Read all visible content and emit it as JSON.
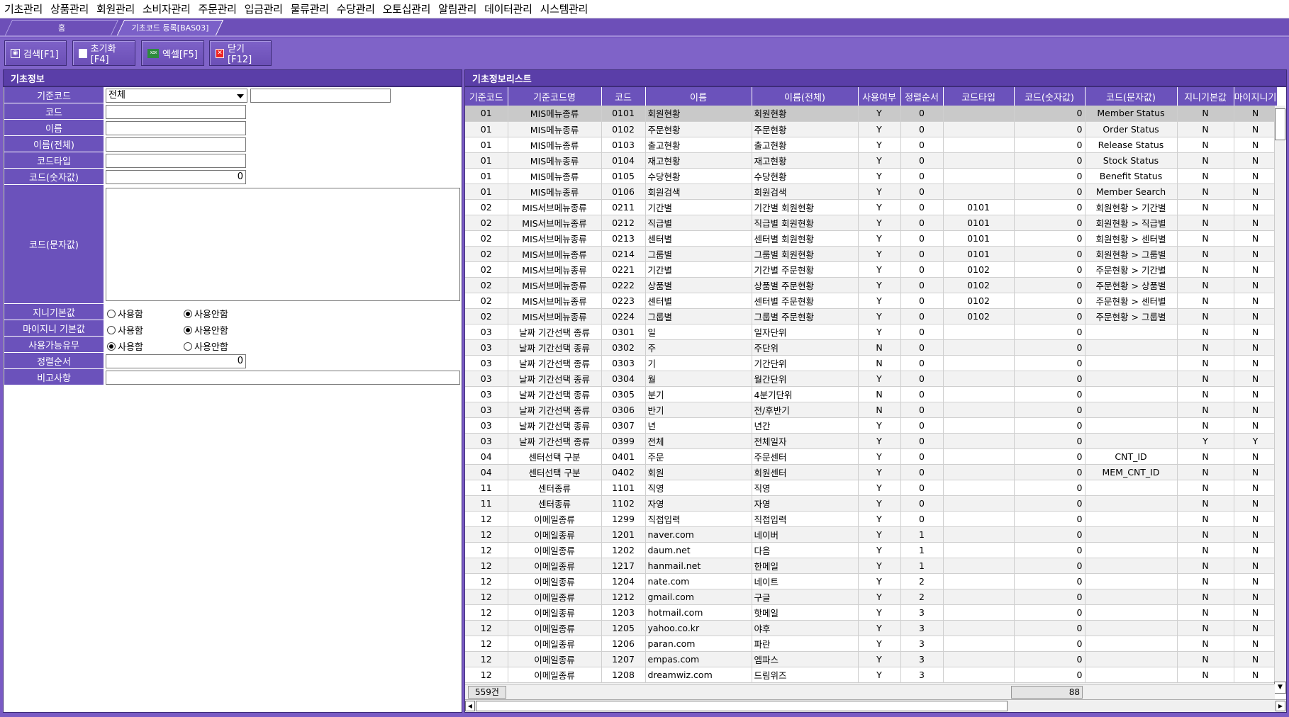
{
  "menu": [
    "기초관리",
    "상품관리",
    "회원관리",
    "소비자관리",
    "주문관리",
    "입금관리",
    "물류관리",
    "수당관리",
    "오토십관리",
    "알림관리",
    "데이터관리",
    "시스템관리"
  ],
  "tabs": {
    "home": "홈",
    "active": "기초코드 등록[BAS03]"
  },
  "toolbar": {
    "search": "검색[F1]",
    "reset": "초기화[F4]",
    "excel": "엑셀[F5]",
    "close": "닫기[F12]",
    "excel_icon_text": "XLSX"
  },
  "left_title": "기초정보",
  "right_title": "기초정보리스트",
  "form": {
    "base_code_label": "기준코드",
    "base_code_value": "전체",
    "base_code_text": "",
    "code_label": "코드",
    "code_value": "",
    "name_label": "이름",
    "name_value": "",
    "fullname_label": "이름(전체)",
    "fullname_value": "",
    "codetype_label": "코드타입",
    "codetype_value": "",
    "codenum_label": "코드(숫자값)",
    "codenum_value": "0",
    "codestr_label": "코드(문자값)",
    "codestr_value": "",
    "jini_label": "지니기본값",
    "minijini_label": "마이지니 기본값",
    "usable_label": "사용가능유무",
    "use": "사용함",
    "notuse": "사용안함",
    "sort_label": "정렬순서",
    "sort_value": "0",
    "remark_label": "비고사항",
    "remark_value": ""
  },
  "grid": {
    "headers": [
      "기준코드",
      "기준코드명",
      "코드",
      "이름",
      "이름(전체)",
      "사용여부",
      "정렬순서",
      "코드타입",
      "코드(숫자값)",
      "코드(문자값)",
      "지니기본값",
      "마이지니기"
    ],
    "rows": [
      [
        "01",
        "MIS메뉴종류",
        "0101",
        "회원현황",
        "회원현황",
        "Y",
        "0",
        "",
        "0",
        "Member Status",
        "N",
        "N"
      ],
      [
        "01",
        "MIS메뉴종류",
        "0102",
        "주문현황",
        "주문현황",
        "Y",
        "0",
        "",
        "0",
        "Order Status",
        "N",
        "N"
      ],
      [
        "01",
        "MIS메뉴종류",
        "0103",
        "출고현황",
        "출고현황",
        "Y",
        "0",
        "",
        "0",
        "Release Status",
        "N",
        "N"
      ],
      [
        "01",
        "MIS메뉴종류",
        "0104",
        "재고현황",
        "재고현황",
        "Y",
        "0",
        "",
        "0",
        "Stock Status",
        "N",
        "N"
      ],
      [
        "01",
        "MIS메뉴종류",
        "0105",
        "수당현황",
        "수당현황",
        "Y",
        "0",
        "",
        "0",
        "Benefit Status",
        "N",
        "N"
      ],
      [
        "01",
        "MIS메뉴종류",
        "0106",
        "회원검색",
        "회원검색",
        "Y",
        "0",
        "",
        "0",
        "Member Search",
        "N",
        "N"
      ],
      [
        "02",
        "MIS서브메뉴종류",
        "0211",
        "기간별",
        "기간별 회원현황",
        "Y",
        "0",
        "0101",
        "0",
        "회원현황 > 기간별",
        "N",
        "N"
      ],
      [
        "02",
        "MIS서브메뉴종류",
        "0212",
        "직급별",
        "직급별 회원현황",
        "Y",
        "0",
        "0101",
        "0",
        "회원현황 > 직급별",
        "N",
        "N"
      ],
      [
        "02",
        "MIS서브메뉴종류",
        "0213",
        "센터별",
        "센터별 회원현황",
        "Y",
        "0",
        "0101",
        "0",
        "회원현황 > 센터별",
        "N",
        "N"
      ],
      [
        "02",
        "MIS서브메뉴종류",
        "0214",
        "그룹별",
        "그룹별 회원현황",
        "Y",
        "0",
        "0101",
        "0",
        "회원현황 > 그룹별",
        "N",
        "N"
      ],
      [
        "02",
        "MIS서브메뉴종류",
        "0221",
        "기간별",
        "기간별 주문현황",
        "Y",
        "0",
        "0102",
        "0",
        "주문현황 > 기간별",
        "N",
        "N"
      ],
      [
        "02",
        "MIS서브메뉴종류",
        "0222",
        "상품별",
        "상품별 주문현황",
        "Y",
        "0",
        "0102",
        "0",
        "주문현황 > 상품별",
        "N",
        "N"
      ],
      [
        "02",
        "MIS서브메뉴종류",
        "0223",
        "센터별",
        "센터별 주문현황",
        "Y",
        "0",
        "0102",
        "0",
        "주문현황 > 센터별",
        "N",
        "N"
      ],
      [
        "02",
        "MIS서브메뉴종류",
        "0224",
        "그룹별",
        "그룹별 주문현황",
        "Y",
        "0",
        "0102",
        "0",
        "주문현황 > 그룹별",
        "N",
        "N"
      ],
      [
        "03",
        "날짜 기간선택 종류",
        "0301",
        "일",
        "일자단위",
        "Y",
        "0",
        "",
        "0",
        "",
        "N",
        "N"
      ],
      [
        "03",
        "날짜 기간선택 종류",
        "0302",
        "주",
        "주단위",
        "N",
        "0",
        "",
        "0",
        "",
        "N",
        "N"
      ],
      [
        "03",
        "날짜 기간선택 종류",
        "0303",
        "기",
        "기간단위",
        "N",
        "0",
        "",
        "0",
        "",
        "N",
        "N"
      ],
      [
        "03",
        "날짜 기간선택 종류",
        "0304",
        "월",
        "월간단위",
        "Y",
        "0",
        "",
        "0",
        "",
        "N",
        "N"
      ],
      [
        "03",
        "날짜 기간선택 종류",
        "0305",
        "분기",
        "4분기단위",
        "N",
        "0",
        "",
        "0",
        "",
        "N",
        "N"
      ],
      [
        "03",
        "날짜 기간선택 종류",
        "0306",
        "반기",
        "전/후반기",
        "N",
        "0",
        "",
        "0",
        "",
        "N",
        "N"
      ],
      [
        "03",
        "날짜 기간선택 종류",
        "0307",
        "년",
        "년간",
        "Y",
        "0",
        "",
        "0",
        "",
        "N",
        "N"
      ],
      [
        "03",
        "날짜 기간선택 종류",
        "0399",
        "전체",
        "전체일자",
        "Y",
        "0",
        "",
        "0",
        "",
        "Y",
        "Y"
      ],
      [
        "04",
        "센터선택 구분",
        "0401",
        "주문",
        "주문센터",
        "Y",
        "0",
        "",
        "0",
        "CNT_ID",
        "N",
        "N"
      ],
      [
        "04",
        "센터선택 구분",
        "0402",
        "회원",
        "회원센터",
        "Y",
        "0",
        "",
        "0",
        "MEM_CNT_ID",
        "N",
        "N"
      ],
      [
        "11",
        "센터종류",
        "1101",
        "직영",
        "직영",
        "Y",
        "0",
        "",
        "0",
        "",
        "N",
        "N"
      ],
      [
        "11",
        "센터종류",
        "1102",
        "자영",
        "자영",
        "Y",
        "0",
        "",
        "0",
        "",
        "N",
        "N"
      ],
      [
        "12",
        "이메일종류",
        "1299",
        "직접입력",
        "직접입력",
        "Y",
        "0",
        "",
        "0",
        "",
        "N",
        "N"
      ],
      [
        "12",
        "이메일종류",
        "1201",
        "naver.com",
        "네이버",
        "Y",
        "1",
        "",
        "0",
        "",
        "N",
        "N"
      ],
      [
        "12",
        "이메일종류",
        "1202",
        "daum.net",
        "다음",
        "Y",
        "1",
        "",
        "0",
        "",
        "N",
        "N"
      ],
      [
        "12",
        "이메일종류",
        "1217",
        "hanmail.net",
        "한메일",
        "Y",
        "1",
        "",
        "0",
        "",
        "N",
        "N"
      ],
      [
        "12",
        "이메일종류",
        "1204",
        "nate.com",
        "네이트",
        "Y",
        "2",
        "",
        "0",
        "",
        "N",
        "N"
      ],
      [
        "12",
        "이메일종류",
        "1212",
        "gmail.com",
        "구글",
        "Y",
        "2",
        "",
        "0",
        "",
        "N",
        "N"
      ],
      [
        "12",
        "이메일종류",
        "1203",
        "hotmail.com",
        "핫메일",
        "Y",
        "3",
        "",
        "0",
        "",
        "N",
        "N"
      ],
      [
        "12",
        "이메일종류",
        "1205",
        "yahoo.co.kr",
        "야후",
        "Y",
        "3",
        "",
        "0",
        "",
        "N",
        "N"
      ],
      [
        "12",
        "이메일종류",
        "1206",
        "paran.com",
        "파란",
        "Y",
        "3",
        "",
        "0",
        "",
        "N",
        "N"
      ],
      [
        "12",
        "이메일종류",
        "1207",
        "empas.com",
        "엠파스",
        "Y",
        "3",
        "",
        "0",
        "",
        "N",
        "N"
      ],
      [
        "12",
        "이메일종류",
        "1208",
        "dreamwiz.com",
        "드림위즈",
        "Y",
        "3",
        "",
        "0",
        "",
        "N",
        "N"
      ]
    ],
    "count": "559건",
    "sum": "88"
  }
}
